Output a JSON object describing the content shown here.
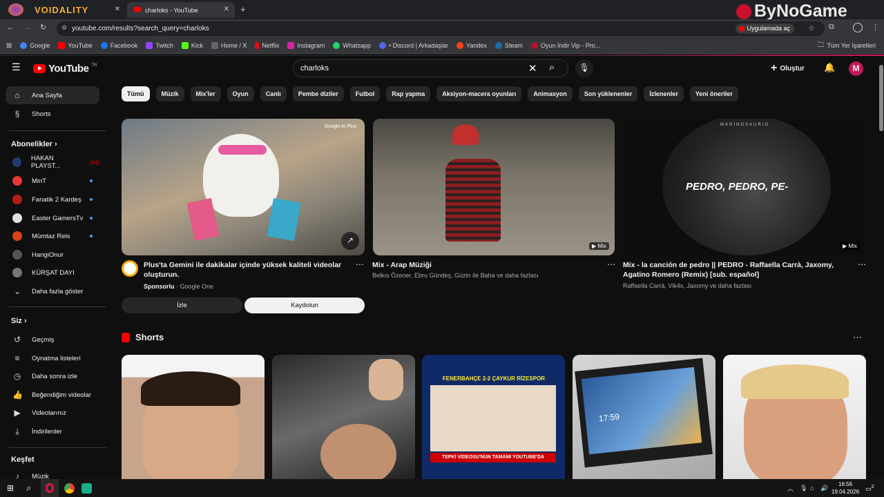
{
  "tabs": [
    {
      "title": "VOIDALITY"
    },
    {
      "title": "charloks - YouTube"
    }
  ],
  "browser": {
    "url": "youtube.com/results?search_query=charloks",
    "open_app": "Uygulamada aç",
    "bookmarks": [
      "Google",
      "YouTube",
      "Facebook",
      "Twitch",
      "Kick",
      "Home / X",
      "Netflix",
      "Instagram",
      "Whatsapp",
      "• Discord | Arkadaşlar",
      "Yandex",
      "Steam",
      "Oyun İndir Vip - Pro..."
    ],
    "all_bookmarks": "Tüm Yer İşaretleri",
    "watermark": "ByNoGame"
  },
  "youtube": {
    "logo": "YouTube",
    "logo_badge": "TR",
    "search_value": "charloks",
    "create": "Oluştur",
    "avatar_letter": "M"
  },
  "sidebar": {
    "main": [
      "Ana Sayfa",
      "Shorts"
    ],
    "subs_title": "Abonelikler",
    "subs": [
      "HAKAN PLAYST...",
      "MinT",
      "Fanatik 2 Kardeş",
      "Easter GamersTv",
      "Mümtaz Reis",
      "HangiOnur",
      "KÜRŞAT DAYI"
    ],
    "show_more": "Daha fazla göster",
    "you_title": "Siz",
    "you": [
      "Geçmiş",
      "Oynatma listeleri",
      "Daha sonra izle",
      "Beğendiğim videolar",
      "Videolarınız",
      "İndirilenler"
    ],
    "explore_title": "Keşfet",
    "explore": [
      "Müzik"
    ]
  },
  "chips": [
    "Tümü",
    "Müzik",
    "Mix'ler",
    "Oyun",
    "Canlı",
    "Pembe diziler",
    "Futbol",
    "Rap yapma",
    "Aksiyon-macera oyunları",
    "Animasyon",
    "Son yüklenenler",
    "İzlenenler",
    "Yeni öneriler"
  ],
  "videos": [
    {
      "title": "Plus'ta Gemini ile dakikalar içinde yüksek kaliteli videolar oluşturun.",
      "meta_bold": "Sponsorlu",
      "meta": " · Google One",
      "badge": "Google AI Plus"
    },
    {
      "title": "Mix - Arap Müziği",
      "meta": "Belkıs Özener, Ebru Gündeş, Güzin ile Baha ve daha fazlası",
      "badge": "Mix"
    },
    {
      "title": "Mix - la canción de pedro || PEDRO - Raffaella Carrà, Jaxomy, Agatino Romero (Remix) [sub. español]",
      "meta": "Raffaella Carrà, Vik4s, Jaxomy ve daha fazlası",
      "badge": "Mix",
      "thumb_text": "PEDRO, PEDRO, PE-",
      "thumb_small": "MARINOSAURIO"
    }
  ],
  "ad_buttons": {
    "watch": "İzle",
    "subscribe": "Kaydolun"
  },
  "shorts": {
    "title": "Shorts",
    "items": [
      {
        "caption": ""
      },
      {
        "caption": ""
      },
      {
        "caption": "FENERBAHÇE  2-2  ÇAYKUR RİZESPOR",
        "bottom": "TEPKİ VİDEOSU'NUN TAMAMI YOUTUBE'DA"
      },
      {
        "caption": "17:59"
      },
      {
        "caption": ""
      }
    ]
  },
  "taskbar": {
    "time": "16:56",
    "date": "19.04.2026",
    "notif": "2"
  }
}
